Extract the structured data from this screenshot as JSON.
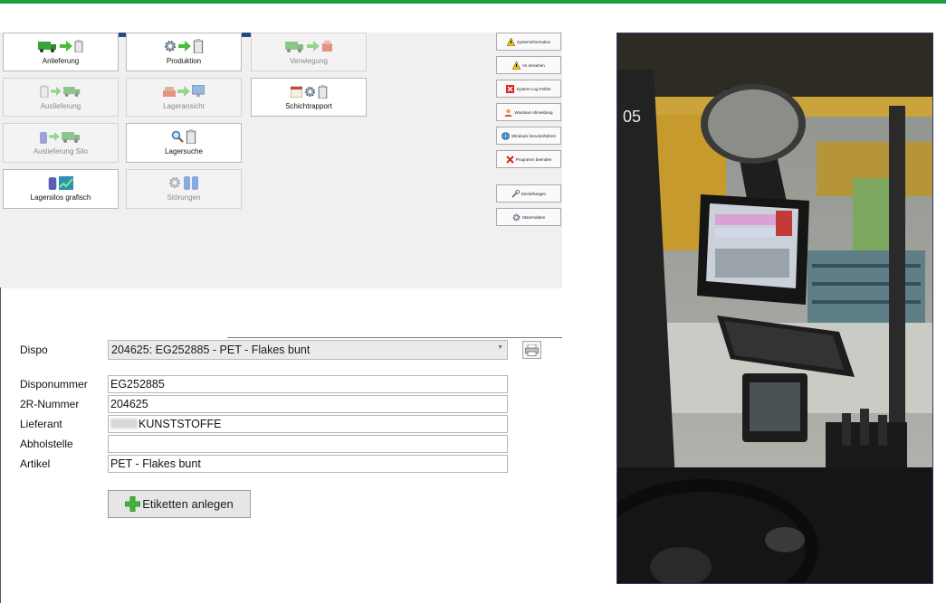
{
  "colors": {
    "accent_bar": "#1e9e3e",
    "title_strip": "#2a4a86",
    "truck_green": "#3aa23a",
    "arrow_green": "#4bbb3b"
  },
  "launcher": {
    "tiles": [
      {
        "label": "Anlieferung",
        "enabled": true,
        "icons": [
          "truck-icon",
          "arrow-right-icon",
          "bag-icon"
        ]
      },
      {
        "label": "Produktion",
        "enabled": true,
        "icons": [
          "gear-icon",
          "arrow-right-icon",
          "bag-icon"
        ]
      },
      {
        "label": "Verwiegung",
        "enabled": false,
        "icons": [
          "truck-icon",
          "arrow-right-icon",
          "scale-icon"
        ]
      },
      {
        "label": "Auslieferung",
        "enabled": false,
        "icons": [
          "bag-icon",
          "arrow-right-icon",
          "truck-icon"
        ]
      },
      {
        "label": "Lageransicht",
        "enabled": false,
        "icons": [
          "materials-icon",
          "arrow-right-icon",
          "monitor-icon"
        ]
      },
      {
        "label": "Schichtrapport",
        "enabled": true,
        "icons": [
          "calendar-icon",
          "gear-icon",
          "bag-icon"
        ]
      },
      {
        "label": "Auslieferung Silo",
        "enabled": false,
        "icons": [
          "silo-icon",
          "arrow-right-icon",
          "truck-icon"
        ]
      },
      {
        "label": "Lagersuche",
        "enabled": true,
        "icons": [
          "magnifier-icon",
          "bag-icon"
        ]
      },
      {
        "label": "Lagersilos grafisch",
        "enabled": true,
        "icons": [
          "silo-icon",
          "chart-icon"
        ]
      },
      {
        "label": "Störungen",
        "enabled": false,
        "icons": [
          "gear-icon",
          "silo-pair-icon"
        ]
      }
    ],
    "side_buttons": [
      {
        "label": "Systeminformation",
        "icon": "warning-icon"
      },
      {
        "label": "Im einsehen",
        "icon": "warning-icon"
      },
      {
        "label": "System-Log Fehler",
        "icon": "error-icon"
      },
      {
        "label": "Windows Abmeldung",
        "icon": "user-icon"
      },
      {
        "label": "Windows herunterfahren",
        "icon": "globe-icon"
      },
      {
        "label": "Programm beenden",
        "icon": "close-icon"
      },
      {
        "label": "Einstellungen",
        "icon": "wrench-icon"
      },
      {
        "label": "Stammdaten",
        "icon": "gear-icon"
      }
    ]
  },
  "form": {
    "dispo_label": "Dispo",
    "dispo_value": "204625: EG252885 - PET - Flakes bunt",
    "fields": [
      {
        "label": "Disponummer",
        "value": "EG252885"
      },
      {
        "label": "2R-Nummer",
        "value": "204625"
      },
      {
        "label": "Lieferant",
        "value": "KUNSTSTOFFE"
      },
      {
        "label": "Abholstelle",
        "value": ""
      },
      {
        "label": "Artikel",
        "value": "PET - Flakes bunt"
      }
    ],
    "action_button": "Etiketten anlegen",
    "action_icon": "plus-icon",
    "print_icon": "printer-icon"
  },
  "photo": {
    "cabin_number": "05"
  }
}
